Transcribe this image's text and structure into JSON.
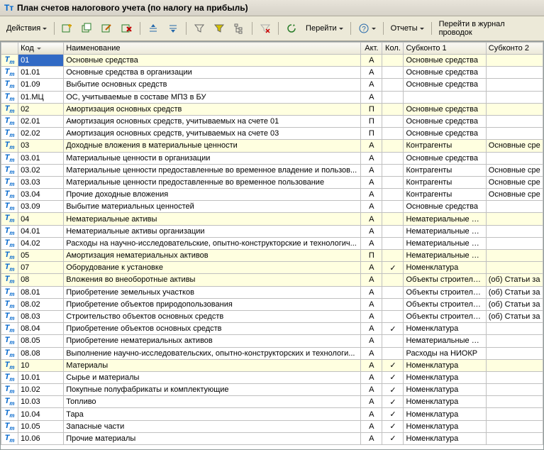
{
  "window": {
    "title": "План счетов налогового учета (по налогу на прибыль)"
  },
  "toolbar": {
    "actions": "Действия",
    "go": "Перейти",
    "reports": "Отчеты",
    "journal": "Перейти в журнал проводок"
  },
  "columns": {
    "code": "Код",
    "name": "Наименование",
    "akt": "Акт.",
    "kol": "Кол.",
    "sub1": "Субконто 1",
    "sub2": "Субконто 2"
  },
  "rows": [
    {
      "code": "01",
      "name": "Основные средства",
      "akt": "А",
      "kol": "",
      "sub1": "Основные средства",
      "sub2": "",
      "group": true,
      "sel": true
    },
    {
      "code": "01.01",
      "name": "Основные средства в организации",
      "akt": "А",
      "kol": "",
      "sub1": "Основные средства",
      "sub2": ""
    },
    {
      "code": "01.09",
      "name": "Выбытие основных средств",
      "akt": "А",
      "kol": "",
      "sub1": "Основные средства",
      "sub2": ""
    },
    {
      "code": "01.МЦ",
      "name": "ОС, учитываемые в составе МПЗ в БУ",
      "akt": "А",
      "kol": "",
      "sub1": "",
      "sub2": ""
    },
    {
      "code": "02",
      "name": "Амортизация основных средств",
      "akt": "П",
      "kol": "",
      "sub1": "Основные средства",
      "sub2": "",
      "group": true
    },
    {
      "code": "02.01",
      "name": "Амортизация основных средств, учитываемых на счете 01",
      "akt": "П",
      "kol": "",
      "sub1": "Основные средства",
      "sub2": ""
    },
    {
      "code": "02.02",
      "name": "Амортизация основных средств, учитываемых на счете 03",
      "akt": "П",
      "kol": "",
      "sub1": "Основные средства",
      "sub2": ""
    },
    {
      "code": "03",
      "name": "Доходные вложения в материальные ценности",
      "akt": "А",
      "kol": "",
      "sub1": "Контрагенты",
      "sub2": "Основные сре",
      "group": true
    },
    {
      "code": "03.01",
      "name": "Материальные ценности в организации",
      "akt": "А",
      "kol": "",
      "sub1": "Основные средства",
      "sub2": ""
    },
    {
      "code": "03.02",
      "name": "Материальные ценности предоставленные во временное владение и пользов...",
      "akt": "А",
      "kol": "",
      "sub1": "Контрагенты",
      "sub2": "Основные сре"
    },
    {
      "code": "03.03",
      "name": "Материальные ценности предоставленные во временное пользование",
      "akt": "А",
      "kol": "",
      "sub1": "Контрагенты",
      "sub2": "Основные сре"
    },
    {
      "code": "03.04",
      "name": "Прочие доходные вложения",
      "akt": "А",
      "kol": "",
      "sub1": "Контрагенты",
      "sub2": "Основные сре"
    },
    {
      "code": "03.09",
      "name": "Выбытие материальных ценностей",
      "akt": "А",
      "kol": "",
      "sub1": "Основные средства",
      "sub2": ""
    },
    {
      "code": "04",
      "name": "Нематериальные активы",
      "akt": "А",
      "kol": "",
      "sub1": "Нематериальные ак...",
      "sub2": "",
      "group": true
    },
    {
      "code": "04.01",
      "name": "Нематериальные активы организации",
      "akt": "А",
      "kol": "",
      "sub1": "Нематериальные ак...",
      "sub2": ""
    },
    {
      "code": "04.02",
      "name": "Расходы на научно-исследовательские, опытно-конструкторские и технологич...",
      "akt": "А",
      "kol": "",
      "sub1": "Нематериальные ак...",
      "sub2": ""
    },
    {
      "code": "05",
      "name": "Амортизация нематериальных активов",
      "akt": "П",
      "kol": "",
      "sub1": "Нематериальные ак...",
      "sub2": "",
      "group": true
    },
    {
      "code": "07",
      "name": "Оборудование к установке",
      "akt": "А",
      "kol": "✓",
      "sub1": "Номенклатура",
      "sub2": "",
      "group": true
    },
    {
      "code": "08",
      "name": "Вложения во внеоборотные активы",
      "akt": "А",
      "kol": "",
      "sub1": "Объекты строитель...",
      "sub2": "(об) Статьи за",
      "group": true
    },
    {
      "code": "08.01",
      "name": "Приобретение земельных участков",
      "akt": "А",
      "kol": "",
      "sub1": "Объекты строитель...",
      "sub2": "(об) Статьи за"
    },
    {
      "code": "08.02",
      "name": "Приобретение объектов природопользования",
      "akt": "А",
      "kol": "",
      "sub1": "Объекты строитель...",
      "sub2": "(об) Статьи за"
    },
    {
      "code": "08.03",
      "name": "Строительство объектов основных средств",
      "akt": "А",
      "kol": "",
      "sub1": "Объекты строитель...",
      "sub2": "(об) Статьи за"
    },
    {
      "code": "08.04",
      "name": "Приобретение объектов основных средств",
      "akt": "А",
      "kol": "✓",
      "sub1": "Номенклатура",
      "sub2": ""
    },
    {
      "code": "08.05",
      "name": "Приобретение нематериальных активов",
      "akt": "А",
      "kol": "",
      "sub1": "Нематериальные ак...",
      "sub2": ""
    },
    {
      "code": "08.08",
      "name": "Выполнение научно-исследовательских, опытно-конструкторских и технологи...",
      "akt": "А",
      "kol": "",
      "sub1": "Расходы на НИОКР",
      "sub2": ""
    },
    {
      "code": "10",
      "name": "Материалы",
      "akt": "А",
      "kol": "✓",
      "sub1": "Номенклатура",
      "sub2": "",
      "group": true
    },
    {
      "code": "10.01",
      "name": "Сырье и материалы",
      "akt": "А",
      "kol": "✓",
      "sub1": "Номенклатура",
      "sub2": ""
    },
    {
      "code": "10.02",
      "name": "Покупные полуфабрикаты и комплектующие",
      "akt": "А",
      "kol": "✓",
      "sub1": "Номенклатура",
      "sub2": ""
    },
    {
      "code": "10.03",
      "name": "Топливо",
      "akt": "А",
      "kol": "✓",
      "sub1": "Номенклатура",
      "sub2": ""
    },
    {
      "code": "10.04",
      "name": "Тара",
      "akt": "А",
      "kol": "✓",
      "sub1": "Номенклатура",
      "sub2": ""
    },
    {
      "code": "10.05",
      "name": "Запасные части",
      "akt": "А",
      "kol": "✓",
      "sub1": "Номенклатура",
      "sub2": ""
    },
    {
      "code": "10.06",
      "name": "Прочие материалы",
      "akt": "А",
      "kol": "✓",
      "sub1": "Номенклатура",
      "sub2": ""
    }
  ]
}
